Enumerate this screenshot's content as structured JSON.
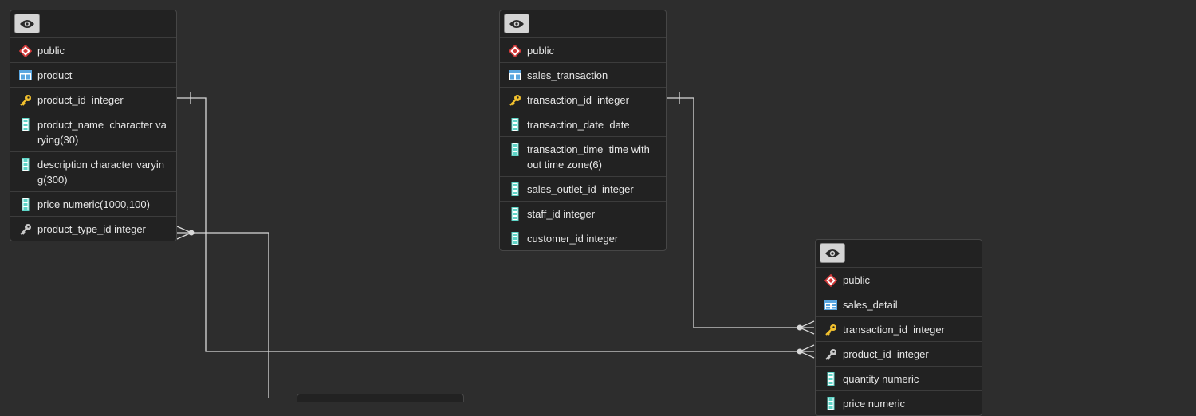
{
  "tables": {
    "product": {
      "schema": "public",
      "name": "product",
      "columns": [
        {
          "text": "product_id  integer",
          "kind": "pk"
        },
        {
          "text": "product_name  character va\nrying(30)",
          "kind": "col"
        },
        {
          "text": "description character varyin\ng(300)",
          "kind": "col"
        },
        {
          "text": "price numeric(1000,100)",
          "kind": "col"
        },
        {
          "text": "product_type_id integer",
          "kind": "fk"
        }
      ]
    },
    "sales_transaction": {
      "schema": "public",
      "name": "sales_transaction",
      "columns": [
        {
          "text": "transaction_id  integer",
          "kind": "pk"
        },
        {
          "text": "transaction_date  date",
          "kind": "col"
        },
        {
          "text": "transaction_time  time with\nout time zone(6)",
          "kind": "col"
        },
        {
          "text": "sales_outlet_id  integer",
          "kind": "col"
        },
        {
          "text": "staff_id integer",
          "kind": "col"
        },
        {
          "text": "customer_id integer",
          "kind": "col"
        }
      ]
    },
    "sales_detail": {
      "schema": "public",
      "name": "sales_detail",
      "columns": [
        {
          "text": "transaction_id  integer",
          "kind": "pk"
        },
        {
          "text": "product_id  integer",
          "kind": "fk"
        },
        {
          "text": "quantity numeric",
          "kind": "col"
        },
        {
          "text": "price numeric",
          "kind": "col"
        }
      ]
    }
  },
  "colors": {
    "background": "#2d2d2d",
    "table_bg": "#222222",
    "border": "#464646",
    "text": "#e6e6e6",
    "edge": "#d9d9d9",
    "pk_key": "#f2c12e",
    "fk_key": "#c9c9c9",
    "column_icon": "#5fd6c8",
    "schema_icon": "#d23a3a",
    "table_icon": "#5aa6e0"
  },
  "icons": {
    "eye": "eye-icon",
    "schema": "schema-icon",
    "table": "table-icon",
    "pk": "primary-key-icon",
    "fk": "foreign-key-icon",
    "column": "column-icon"
  }
}
